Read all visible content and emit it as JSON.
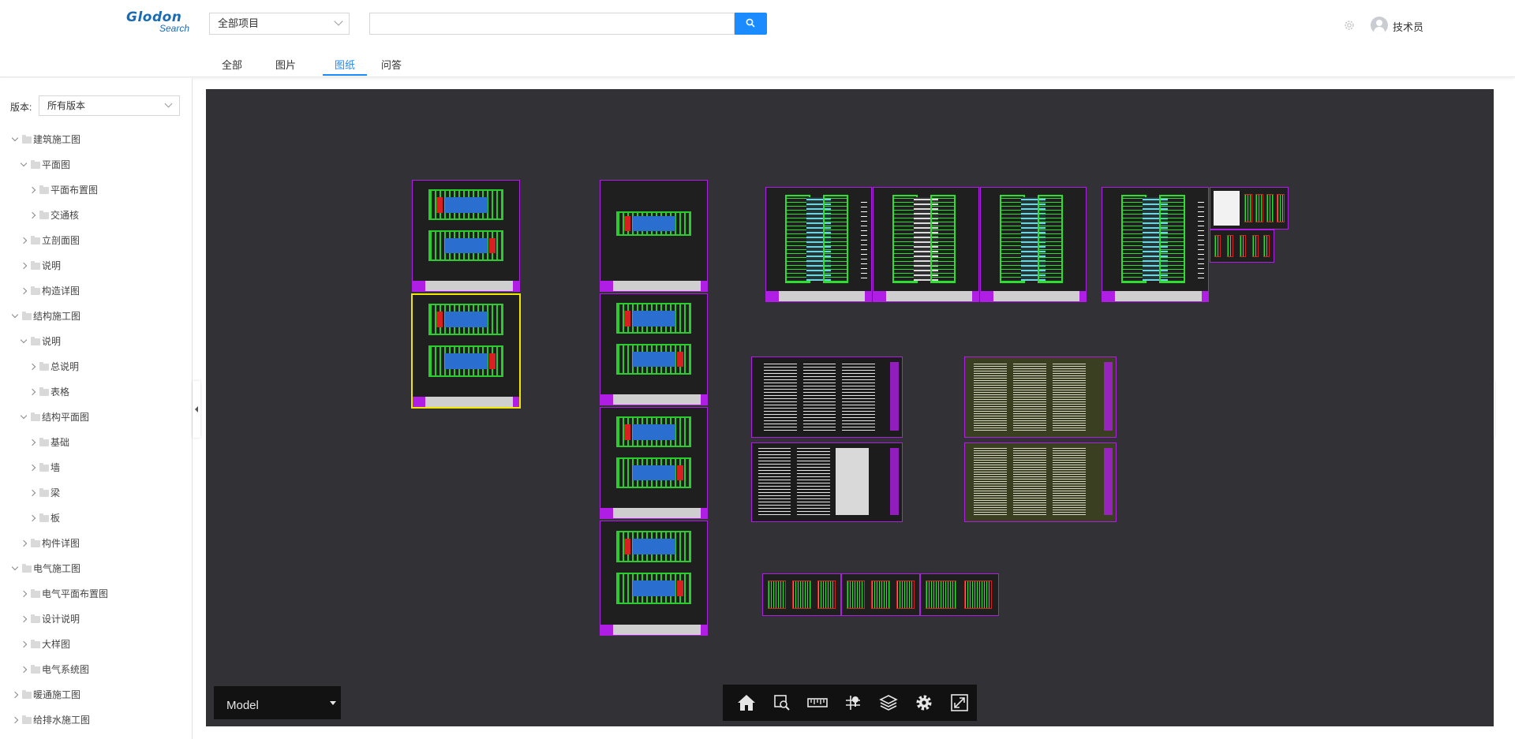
{
  "header": {
    "logo_main": "Glodon",
    "logo_sub": "Search",
    "project_select": "全部项目",
    "search_value": "",
    "username": "技术员",
    "tabs": [
      {
        "label": "全部",
        "active": false
      },
      {
        "label": "图片",
        "active": false
      },
      {
        "label": "图纸",
        "active": true
      },
      {
        "label": "问答",
        "active": false
      }
    ]
  },
  "sidebar": {
    "version_label": "版本:",
    "version_value": "所有版本",
    "tree": [
      {
        "label": "建筑施工图",
        "level": 0,
        "expanded": true
      },
      {
        "label": "平面图",
        "level": 1,
        "expanded": true
      },
      {
        "label": "平面布置图",
        "level": 2,
        "expanded": false
      },
      {
        "label": "交通核",
        "level": 2,
        "expanded": false
      },
      {
        "label": "立剖面图",
        "level": 1,
        "expanded": false
      },
      {
        "label": "说明",
        "level": 1,
        "expanded": false
      },
      {
        "label": "构造详图",
        "level": 1,
        "expanded": false
      },
      {
        "label": "结构施工图",
        "level": 0,
        "expanded": true
      },
      {
        "label": "说明",
        "level": 1,
        "expanded": true
      },
      {
        "label": "总说明",
        "level": 2,
        "expanded": false
      },
      {
        "label": "表格",
        "level": 2,
        "expanded": false
      },
      {
        "label": "结构平面图",
        "level": 1,
        "expanded": true
      },
      {
        "label": "基础",
        "level": 2,
        "expanded": false
      },
      {
        "label": "墙",
        "level": 2,
        "expanded": false
      },
      {
        "label": "梁",
        "level": 2,
        "expanded": false
      },
      {
        "label": "板",
        "level": 2,
        "expanded": false
      },
      {
        "label": "构件详图",
        "level": 1,
        "expanded": false
      },
      {
        "label": "电气施工图",
        "level": 0,
        "expanded": true
      },
      {
        "label": "电气平面布置图",
        "level": 1,
        "expanded": false
      },
      {
        "label": "设计说明",
        "level": 1,
        "expanded": false
      },
      {
        "label": "大样图",
        "level": 1,
        "expanded": false
      },
      {
        "label": "电气系统图",
        "level": 1,
        "expanded": false
      },
      {
        "label": "暖通施工图",
        "level": 0,
        "expanded": false
      },
      {
        "label": "给排水施工图",
        "level": 0,
        "expanded": false
      }
    ]
  },
  "viewer": {
    "model_select": "Model",
    "tools": [
      "home-icon",
      "zoom-window-icon",
      "measure-icon",
      "explode-icon",
      "layers-icon",
      "settings-icon",
      "fullscreen-icon"
    ],
    "colors": {
      "background": "#323136",
      "sheet_border": "#b01ee6",
      "selected_border": "#f0e800",
      "linework": "#2ae02f"
    }
  }
}
